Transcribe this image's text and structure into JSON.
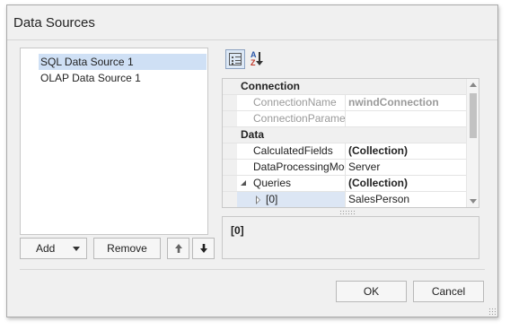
{
  "window": {
    "title": "Data Sources"
  },
  "data_sources": {
    "items": [
      {
        "label": "SQL Data Source 1",
        "selected": true
      },
      {
        "label": "OLAP Data Source 1",
        "selected": false
      }
    ]
  },
  "list_buttons": {
    "add_label": "Add",
    "remove_label": "Remove"
  },
  "property_grid": {
    "toolbar": {
      "categorized_icon": "categorized-grid-icon",
      "sort_icon": "sort-az-icon"
    },
    "rows": [
      {
        "type": "category",
        "name": "Connection"
      },
      {
        "type": "property",
        "name": "ConnectionName",
        "value": "nwindConnection",
        "disabled": true,
        "bold": true
      },
      {
        "type": "property",
        "name": "ConnectionParamete",
        "value": "",
        "disabled": true
      },
      {
        "type": "category",
        "name": "Data"
      },
      {
        "type": "property",
        "name": "CalculatedFields",
        "value": "(Collection)",
        "bold": true
      },
      {
        "type": "property",
        "name": "DataProcessingMode",
        "value": "Server"
      },
      {
        "type": "property",
        "name": "Queries",
        "value": "(Collection)",
        "bold": true,
        "expanded": true
      },
      {
        "type": "property",
        "name": "[0]",
        "value": "SalesPerson",
        "selected": true,
        "collapsed": true
      }
    ]
  },
  "description": {
    "title": "[0]"
  },
  "footer": {
    "ok_label": "OK",
    "cancel_label": "Cancel"
  },
  "colors": {
    "selection": "#cfe0f5",
    "dialog_bg": "#f0f0f0",
    "border": "#a9a9a9"
  }
}
